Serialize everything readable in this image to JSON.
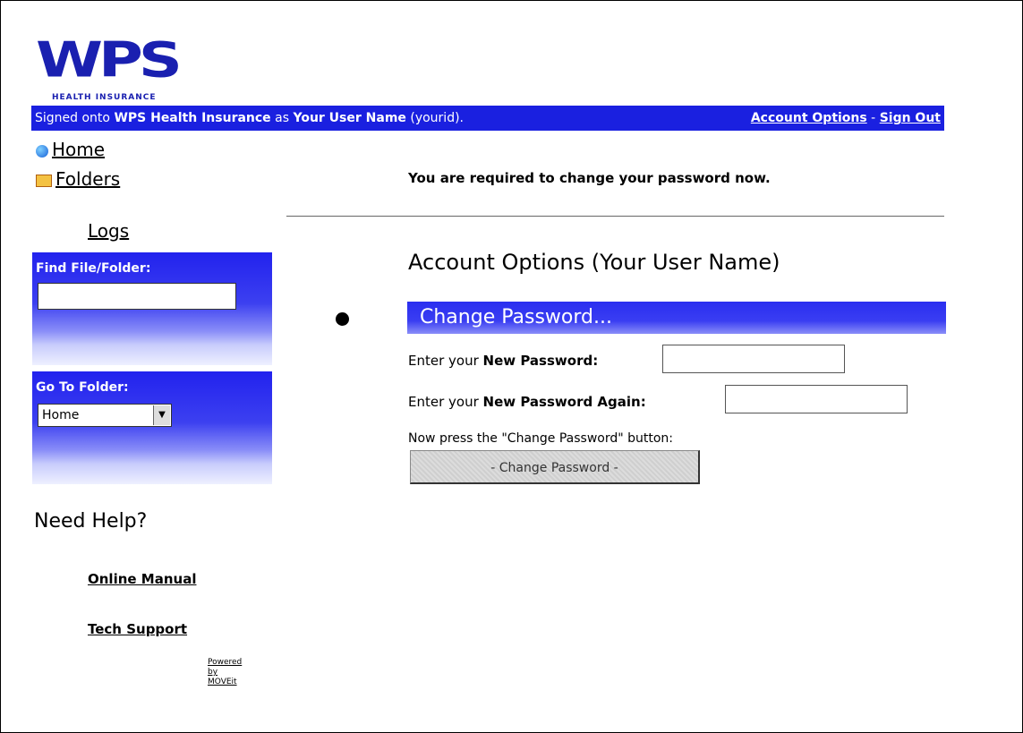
{
  "logo": {
    "main": "WPS",
    "sub": "HEALTH INSURANCE"
  },
  "topbar": {
    "signed_prefix": "Signed onto ",
    "org": "WPS Health Insurance",
    "as_text": " as ",
    "user": "Your User Name",
    "user_id": " (yourid).",
    "account_options": "Account Options",
    "separator": " - ",
    "sign_out": "Sign Out"
  },
  "nav": {
    "home": "Home",
    "folders": "Folders",
    "logs": "Logs"
  },
  "find": {
    "label": "Find File/Folder:"
  },
  "goto": {
    "label": "Go To Folder:",
    "selected": "Home"
  },
  "help": {
    "title": "Need Help?",
    "manual": "Online Manual",
    "tech": "Tech Support"
  },
  "powered": {
    "line1": "Powered",
    "line2": "by",
    "line3": "MOVEit"
  },
  "main": {
    "notice": "You are required to change your password now.",
    "account_title": "Account Options (Your User Name)",
    "change_bar": "Change Password...",
    "pw_prefix": "Enter your ",
    "pw1_label": "New Password:",
    "pw2_label": "New Password Again:",
    "instruction": "Now press the \"Change Password\" button:",
    "button": "- Change Password -"
  }
}
